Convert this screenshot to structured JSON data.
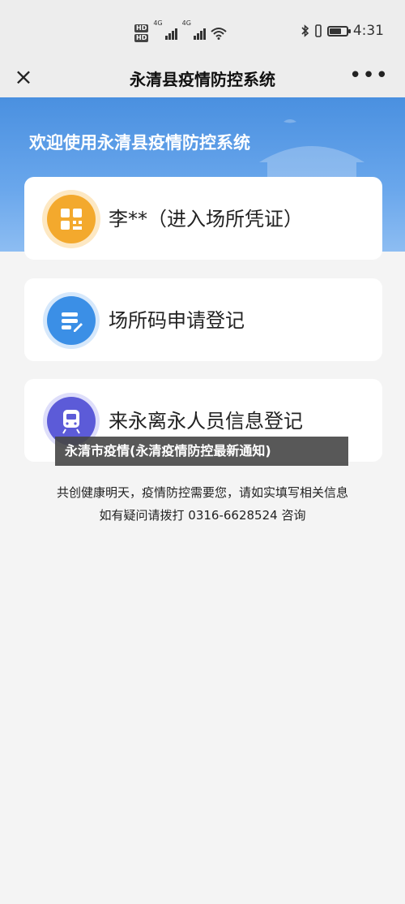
{
  "status_bar": {
    "hd_labels": [
      "HD",
      "HD"
    ],
    "network_labels": [
      "4G",
      "4G"
    ],
    "time": "4:31",
    "battery_level": 0.75
  },
  "nav": {
    "title": "永清县疫情防控系统",
    "close_icon": "×",
    "more_icon": "•••"
  },
  "banner": {
    "welcome": "欢迎使用永清县疫情防控系统"
  },
  "cards": [
    {
      "label": "李**（进入场所凭证）",
      "icon": "qr-code-icon",
      "color": "#f3a92d"
    },
    {
      "label": "场所码申请登记",
      "icon": "edit-form-icon",
      "color": "#3b8fe6"
    },
    {
      "label": "来永离永人员信息登记",
      "icon": "train-icon",
      "color": "#5c5bd8"
    }
  ],
  "overlay_caption": "永清市疫情(永清疫情防控最新通知)",
  "footer": {
    "line1": "共创健康明天，疫情防控需要您，请如实填写相关信息",
    "line2": "如有疑问请拨打 0316-6628524 咨询"
  }
}
